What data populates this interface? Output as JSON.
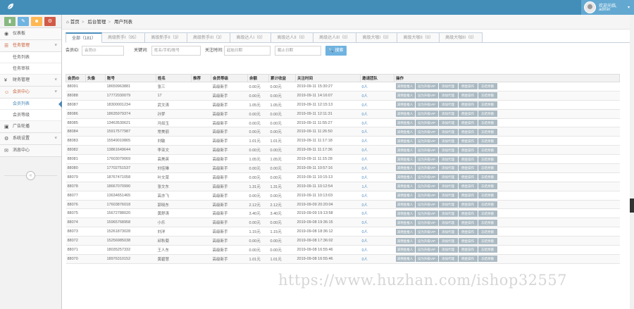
{
  "topbar": {
    "color": "#438eb9",
    "user_welcome": "欢迎光临,",
    "user_name": "admin"
  },
  "sidebar": {
    "shortcuts": [
      {
        "icon": "signal-icon",
        "color": "#87b87f"
      },
      {
        "icon": "pencil-icon",
        "color": "#6fb3e0"
      },
      {
        "icon": "users-icon",
        "color": "#ffb752"
      },
      {
        "icon": "cogs-icon",
        "color": "#d15b47"
      }
    ],
    "items": [
      {
        "label": "仪表板",
        "icon": "dashboard-icon",
        "arrow": ""
      },
      {
        "label": "任务管理",
        "icon": "list-icon",
        "arrow": "˅",
        "open": true
      },
      {
        "label": "任务列表",
        "sub": true
      },
      {
        "label": "任务审核",
        "sub": true
      },
      {
        "label": "财务管理",
        "icon": "money-icon",
        "arrow": "˅"
      },
      {
        "label": "会员中心",
        "icon": "user-icon",
        "arrow": "˅",
        "open": true
      },
      {
        "label": "会员列表",
        "sub": true,
        "active": true
      },
      {
        "label": "会员等级",
        "sub": true
      },
      {
        "label": "广告轮播",
        "icon": "picture-icon",
        "arrow": ""
      },
      {
        "label": "系统设置",
        "icon": "cog-icon",
        "arrow": "˅"
      },
      {
        "label": "消息中心",
        "icon": "message-icon",
        "arrow": ""
      }
    ]
  },
  "breadcrumb": [
    "首页",
    "后台管理",
    "用户列表"
  ],
  "tabs": [
    "全部（181）",
    "高级新手I（95）",
    "高级新手II（3）",
    "高级新手III（3）",
    "高级达人I（0）",
    "高级达人II（0）",
    "高级达人III（0）",
    "高级大咖I（0）",
    "高级大咖II（0）",
    "高级大咖III（0）"
  ],
  "search": {
    "id_label": "会员ID:",
    "id_placeholder": "会员ID",
    "kw_label": "关键词:",
    "kw_placeholder": "姓名/手机/账号",
    "time_label": "关注时间:",
    "start_placeholder": "起始日期",
    "end_placeholder": "截止日期",
    "button": "🔍 搜索"
  },
  "table": {
    "headers": [
      "会员ID",
      "头像",
      "账号",
      "姓名",
      "推荐",
      "会员等级",
      "余额",
      "累计收益",
      "关注时间",
      "邀请团队",
      "操作"
    ],
    "actions": [
      "减佣金推人",
      "设为升级VIP",
      "添加代理",
      "佣金操作",
      "冻结余额"
    ],
    "rows": [
      [
        "88091",
        "",
        "18659963881",
        "张三",
        "",
        "高级新手",
        "0.00元",
        "0.00元",
        "2019-09-11 15:30:27",
        "0人"
      ],
      [
        "88088",
        "",
        "17772030079",
        "17",
        "",
        "高级新手",
        "0.00元",
        "0.00元",
        "2019-09-11 14:16:07",
        "0人"
      ],
      [
        "88087",
        "",
        "18300001234",
        "武文涛",
        "",
        "高级新手",
        "1.05元",
        "1.05元",
        "2019-09-11 12:15:13",
        "0人"
      ],
      [
        "88086",
        "",
        "18635979374",
        "孙梦",
        "",
        "高级新手",
        "0.00元",
        "0.00元",
        "2019-09-11 12:11:31",
        "0人"
      ],
      [
        "88085",
        "",
        "13463530621",
        "冯如玉",
        "",
        "高级新手",
        "0.00元",
        "0.00元",
        "2019-09-11 11:55:27",
        "0人"
      ],
      [
        "88084",
        "",
        "15917577987",
        "常美丽",
        "",
        "高级新手",
        "0.00元",
        "0.00元",
        "2019-09-11 11:26:50",
        "0人"
      ],
      [
        "88083",
        "",
        "15549010865",
        "刘敏",
        "",
        "高级新手",
        "1.01元",
        "1.01元",
        "2019-09-11 11:17:18",
        "0人"
      ],
      [
        "88082",
        "",
        "13861649644",
        "李亚文",
        "",
        "高级新手",
        "0.00元",
        "0.00元",
        "2019-09-11 11:17:36",
        "0人"
      ],
      [
        "88081",
        "",
        "17603079069",
        "高美英",
        "",
        "高级新手",
        "1.05元",
        "1.05元",
        "2019-09-11 11:15:28",
        "0人"
      ],
      [
        "88080",
        "",
        "17702751537",
        "刘佳琳",
        "",
        "高级新手",
        "0.00元",
        "0.00元",
        "2019-09-11 10:57:16",
        "0人"
      ],
      [
        "88079",
        "",
        "18767471058",
        "叶文荣",
        "",
        "高级新手",
        "0.00元",
        "0.00元",
        "2019-09-11 10:15:13",
        "0人"
      ],
      [
        "88078",
        "",
        "18667070990",
        "张文东",
        "",
        "高级新手",
        "1.31元",
        "1.31元",
        "2019-09-11 10:12:54",
        "1人"
      ],
      [
        "88077",
        "",
        "13634651465",
        "高亦飞",
        "",
        "高级新手",
        "0.00元",
        "0.00元",
        "2019-09-11 10:13:03",
        "0人"
      ],
      [
        "88076",
        "",
        "17603876018",
        "郭晓东",
        "",
        "高级新手",
        "2.12元",
        "2.12元",
        "2019-09-09 20:20:04",
        "0人"
      ],
      [
        "88075",
        "",
        "15672788020",
        "黄舒涛",
        "",
        "高级新手",
        "3.40元",
        "3.40元",
        "2019-09-09 19:13:58",
        "0人"
      ],
      [
        "88074",
        "",
        "15965768958",
        "小乐",
        "",
        "高级新手",
        "0.00元",
        "0.00元",
        "2019-09-08 19:36:15",
        "0人"
      ],
      [
        "88073",
        "",
        "15261873028",
        "刘洋",
        "",
        "高级新手",
        "1.15元",
        "1.15元",
        "2019-09-08 18:36:12",
        "0人"
      ],
      [
        "88072",
        "",
        "15256985038",
        "邱秋菊",
        "",
        "高级新手",
        "0.00元",
        "0.00元",
        "2019-09-08 17:36:02",
        "0人"
      ],
      [
        "88071",
        "",
        "18035257332",
        "王人东",
        "",
        "高级新手",
        "0.00元",
        "0.00元",
        "2019-09-08 16:55:46",
        "0人"
      ],
      [
        "88070",
        "",
        "18976310152",
        "黄碧慧",
        "",
        "高级新手",
        "1.01元",
        "1.01元",
        "2019-09-08 16:55:46",
        "0人"
      ]
    ]
  },
  "watermark": "https://www.huzhan.com/ishop32557"
}
